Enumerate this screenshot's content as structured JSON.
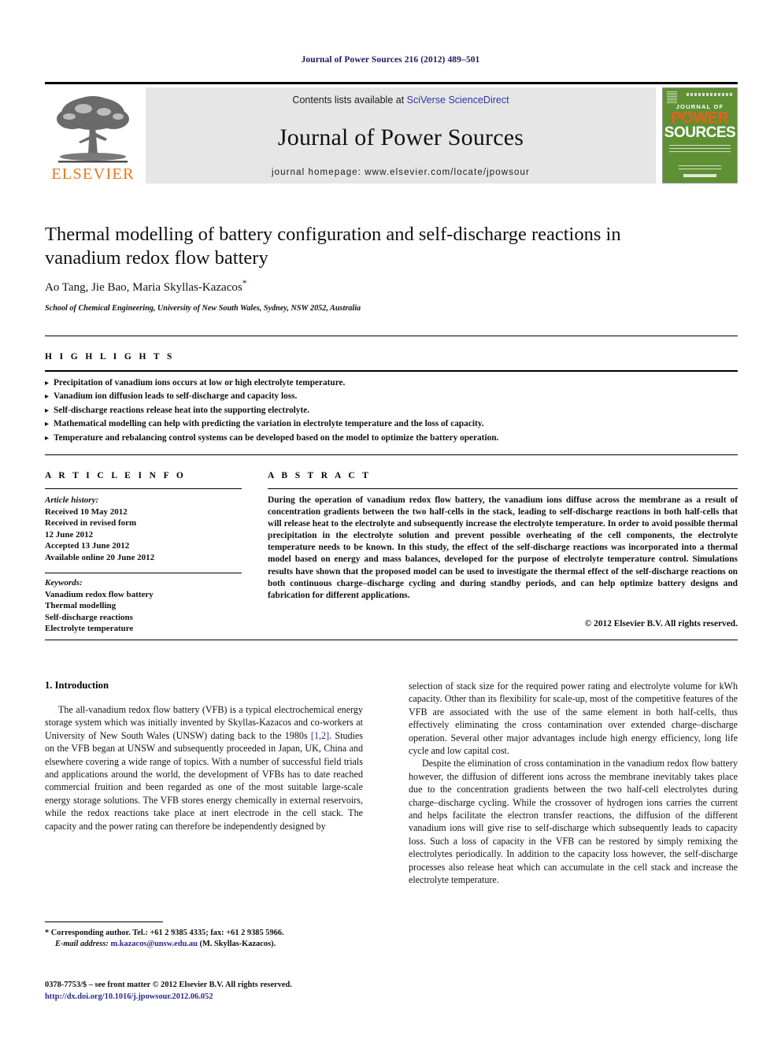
{
  "running_head": "Journal of Power Sources 216 (2012) 489–501",
  "masthead": {
    "publisher_logo_text": "ELSEVIER",
    "contents_prefix": "Contents lists available at ",
    "contents_link": "SciVerse ScienceDirect",
    "journal_name": "Journal of Power Sources",
    "homepage_line": "journal homepage: www.elsevier.com/locate/jpowsour",
    "cover": {
      "journal_of": "JOURNAL OF",
      "power": "POWER",
      "sources": "SOURCES"
    },
    "colors": {
      "link_blue": "#3333aa",
      "elsevier_orange": "#E87722",
      "cover_green": "#5f9134",
      "cover_orange": "#E8601C",
      "contents_bg": "#e6e6e6"
    }
  },
  "article": {
    "title": "Thermal modelling of battery configuration and self-discharge reactions in vanadium redox flow battery",
    "authors": "Ao Tang, Jie Bao, Maria Skyllas-Kazacos",
    "author_star": "*",
    "affiliation": "School of Chemical Engineering, University of New South Wales, Sydney, NSW 2052, Australia"
  },
  "highlights": {
    "heading": "H I G H L I G H T S",
    "items": [
      "Precipitation of vanadium ions occurs at low or high electrolyte temperature.",
      "Vanadium ion diffusion leads to self-discharge and capacity loss.",
      "Self-discharge reactions release heat into the supporting electrolyte.",
      "Mathematical modelling can help with predicting the variation in electrolyte temperature and the loss of capacity.",
      "Temperature and rebalancing control systems can be developed based on the model to optimize the battery operation."
    ]
  },
  "article_info": {
    "heading": "A R T I C L E   I N F O",
    "history_label": "Article history:",
    "history": [
      "Received 10 May 2012",
      "Received in revised form",
      "12 June 2012",
      "Accepted 13 June 2012",
      "Available online 20 June 2012"
    ],
    "keywords_label": "Keywords:",
    "keywords": [
      "Vanadium redox flow battery",
      "Thermal modelling",
      "Self-discharge reactions",
      "Electrolyte temperature"
    ]
  },
  "abstract": {
    "heading": "A B S T R A C T",
    "text": "During the operation of vanadium redox flow battery, the vanadium ions diffuse across the membrane as a result of concentration gradients between the two half-cells in the stack, leading to self-discharge reactions in both half-cells that will release heat to the electrolyte and subsequently increase the electrolyte temperature. In order to avoid possible thermal precipitation in the electrolyte solution and prevent possible overheating of the cell components, the electrolyte temperature needs to be known. In this study, the effect of the self-discharge reactions was incorporated into a thermal model based on energy and mass balances, developed for the purpose of electrolyte temperature control. Simulations results have shown that the proposed model can be used to investigate the thermal effect of the self-discharge reactions on both continuous charge–discharge cycling and during standby periods, and can help optimize battery designs and fabrication for different applications.",
    "copyright": "© 2012 Elsevier B.V. All rights reserved."
  },
  "introduction": {
    "section_heading": "1.  Introduction",
    "left_para_1_a": "The all-vanadium redox flow battery (VFB) is a typical electrochemical energy storage system which was initially invented by Skyllas-Kazacos and co-workers at University of New South Wales (UNSW) dating back to the 1980s ",
    "left_ref": "[1,2]",
    "left_para_1_b": ". Studies on the VFB began at UNSW and subsequently proceeded in Japan, UK, China and elsewhere covering a wide range of topics. With a number of successful field trials and applications around the world, the development of VFBs has to date reached commercial fruition and been regarded as one of the most suitable large-scale energy storage solutions. The VFB stores energy chemically in external reservoirs, while the redox reactions take place at inert electrode in the cell stack. The capacity and the power rating can therefore be independently designed by",
    "right_para_1": "selection of stack size for the required power rating and electrolyte volume for kWh capacity. Other than its flexibility for scale-up, most of the competitive features of the VFB are associated with the use of the same element in both half-cells, thus effectively eliminating the cross contamination over extended charge–discharge operation. Several other major advantages include high energy efficiency, long life cycle and low capital cost.",
    "right_para_2": "Despite the elimination of cross contamination in the vanadium redox flow battery however, the diffusion of different ions across the membrane inevitably takes place due to the concentration gradients between the two half-cell electrolytes during charge–discharge cycling. While the crossover of hydrogen ions carries the current and helps facilitate the electron transfer reactions, the diffusion of the different vanadium ions will give rise to self-discharge which subsequently leads to capacity loss. Such a loss of capacity in the VFB can be restored by simply remixing the electrolytes periodically. In addition to the capacity loss however, the self-discharge processes also release heat which can accumulate in the cell stack and increase the electrolyte temperature."
  },
  "footnotes": {
    "corresponding": "* Corresponding author. Tel.: +61 2 9385 4335; fax: +61 2 9385 5966.",
    "email_label": "E-mail address:",
    "email": "m.kazacos@unsw.edu.au",
    "email_owner": "(M. Skyllas-Kazacos).",
    "issn_line": "0378-7753/$ – see front matter © 2012 Elsevier B.V. All rights reserved.",
    "doi": "http://dx.doi.org/10.1016/j.jpowsour.2012.06.052"
  }
}
